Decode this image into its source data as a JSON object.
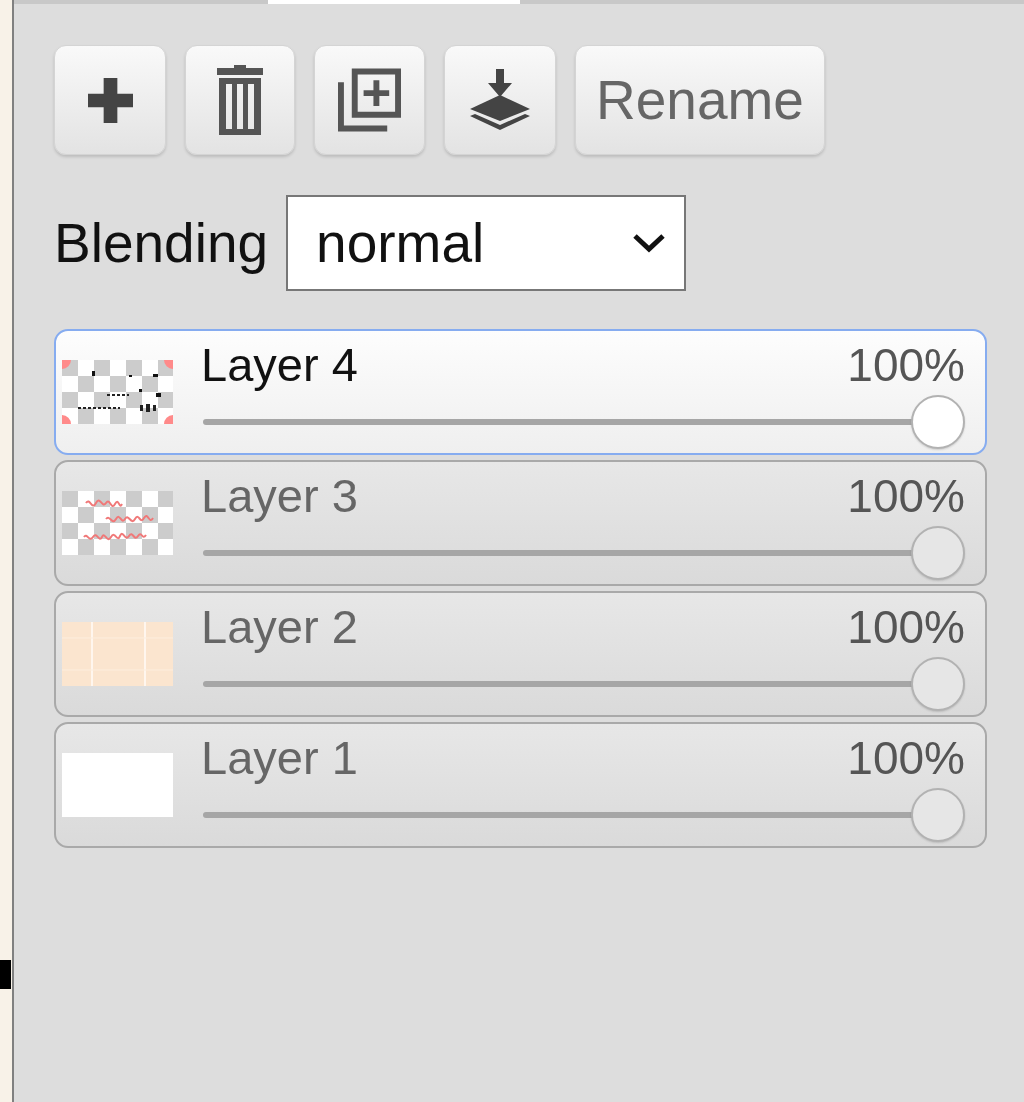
{
  "tabs": [
    {
      "selected": false
    },
    {
      "selected": true
    },
    {
      "selected": false
    }
  ],
  "toolbar": {
    "rename": "Rename"
  },
  "blending": {
    "label": "Blending",
    "value": "normal"
  },
  "layers": [
    {
      "kind": "marks",
      "name": "Layer 4",
      "opacity": "100%",
      "level": 1,
      "selected": true
    },
    {
      "kind": "script",
      "name": "Layer 3",
      "opacity": "100%",
      "level": 1,
      "selected": false
    },
    {
      "kind": "grid",
      "name": "Layer 2",
      "opacity": "100%",
      "level": 1,
      "selected": false
    },
    {
      "kind": "blank",
      "name": "Layer 1",
      "opacity": "100%",
      "level": 1,
      "selected": false
    }
  ]
}
